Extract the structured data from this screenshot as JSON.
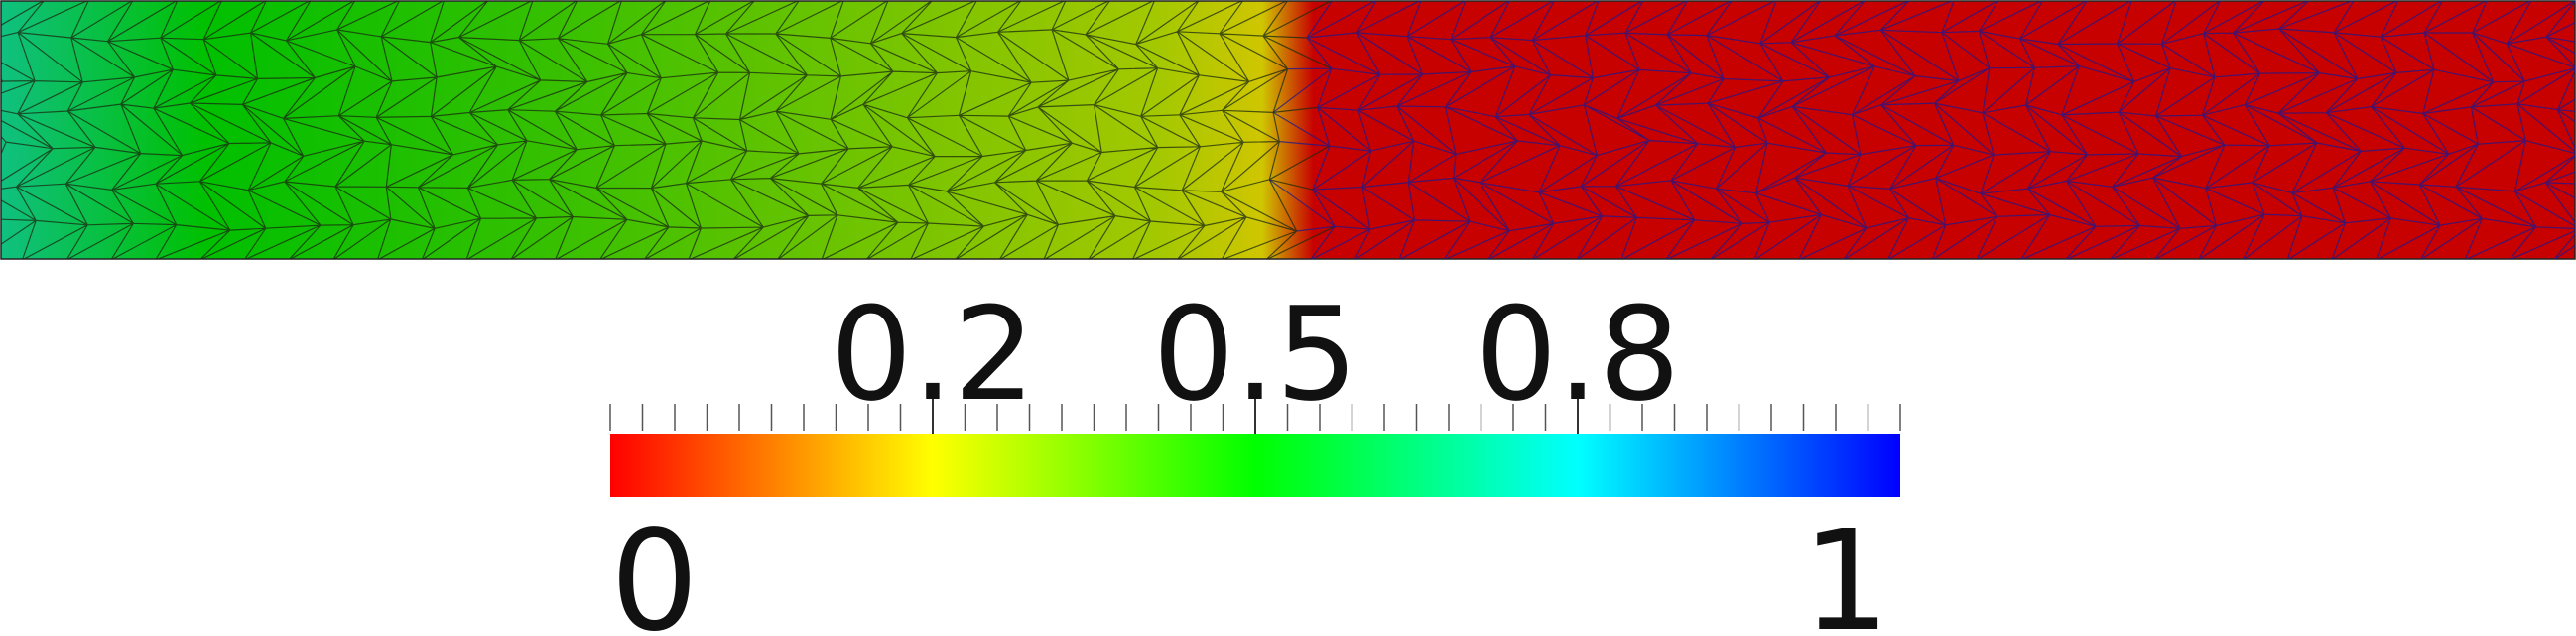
{
  "colors": {
    "field_stops": [
      "#10c080",
      "#00c000",
      "#30c000",
      "#78c400",
      "#a4c800",
      "#cfc600",
      "#c70000"
    ],
    "colormap_stops": [
      "#ff0000",
      "#ffff00",
      "#00ff00",
      "#00ffff",
      "#0000ff"
    ],
    "mesh_line_left": "#1a2a10",
    "mesh_line_right": "#1a1a90",
    "background": "#ffffff"
  },
  "colorbar": {
    "range": [
      0,
      1
    ],
    "min_label": "0",
    "max_label": "1",
    "major_ticks": [
      {
        "value": 0.25,
        "label": "0.2"
      },
      {
        "value": 0.5,
        "label": "0.5"
      },
      {
        "value": 0.75,
        "label": "0.8"
      }
    ],
    "minor_tick_count": 41
  },
  "chart_data": {
    "type": "heatmap",
    "colormap": "red-yellow-green-cyan-blue",
    "range": [
      0,
      1
    ],
    "legend": "bottom"
  }
}
